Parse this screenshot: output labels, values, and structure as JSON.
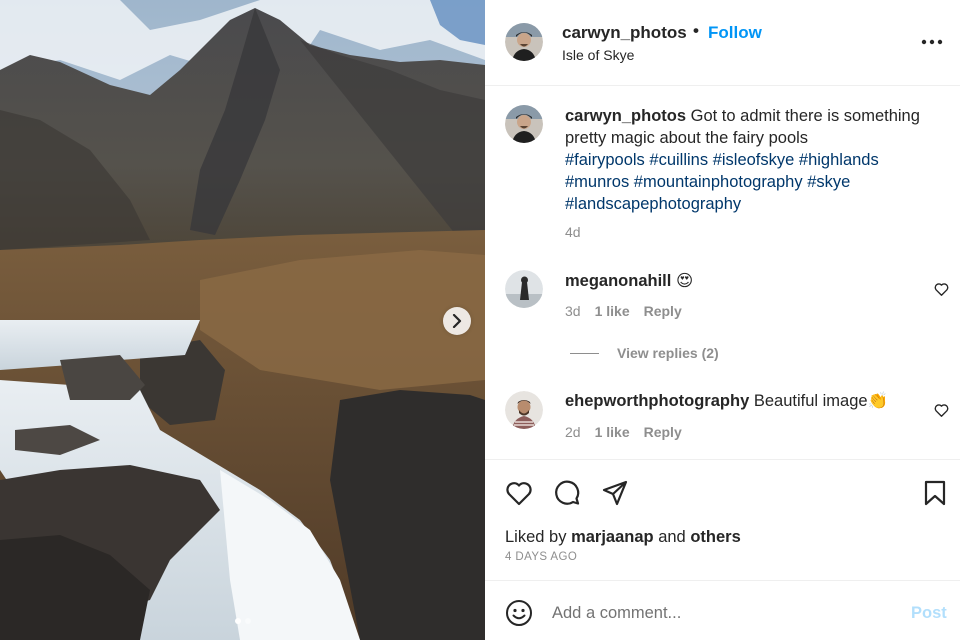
{
  "post": {
    "username": "carwyn_photos",
    "separator": "•",
    "follow_label": "Follow",
    "location": "Isle of Skye",
    "more_icon": "more-options-icon",
    "caption": {
      "username": "carwyn_photos",
      "text": "Got to admit there is something pretty magic about the fairy pools",
      "hashtags": [
        "#fairypools",
        "#cuillins",
        "#isleofskye",
        "#highlands",
        "#munros",
        "#mountainphotography",
        "#skye",
        "#landscapephotography"
      ],
      "age": "4d"
    },
    "comments": [
      {
        "username": "meganonahill",
        "text": "😍",
        "age": "3d",
        "likes": "1 like",
        "reply_label": "Reply"
      },
      {
        "username": "ehepworthphotography",
        "text": "Beautiful image👏",
        "age": "2d",
        "likes": "1 like",
        "reply_label": "Reply"
      }
    ],
    "view_replies_label": "View replies (2)",
    "liked_by_prefix": "Liked by",
    "liked_by_user": "marjaanap",
    "liked_by_and": "and",
    "liked_by_others": "others",
    "date": "4 DAYS AGO",
    "carousel": {
      "slide_count": 2,
      "current_index": 0
    }
  },
  "composer": {
    "placeholder": "Add a comment...",
    "post_label": "Post"
  },
  "colors": {
    "accent": "#0095f6",
    "hashtag": "#00376b",
    "post_disabled": "#b2dffc",
    "muted": "#8e8e8e"
  }
}
